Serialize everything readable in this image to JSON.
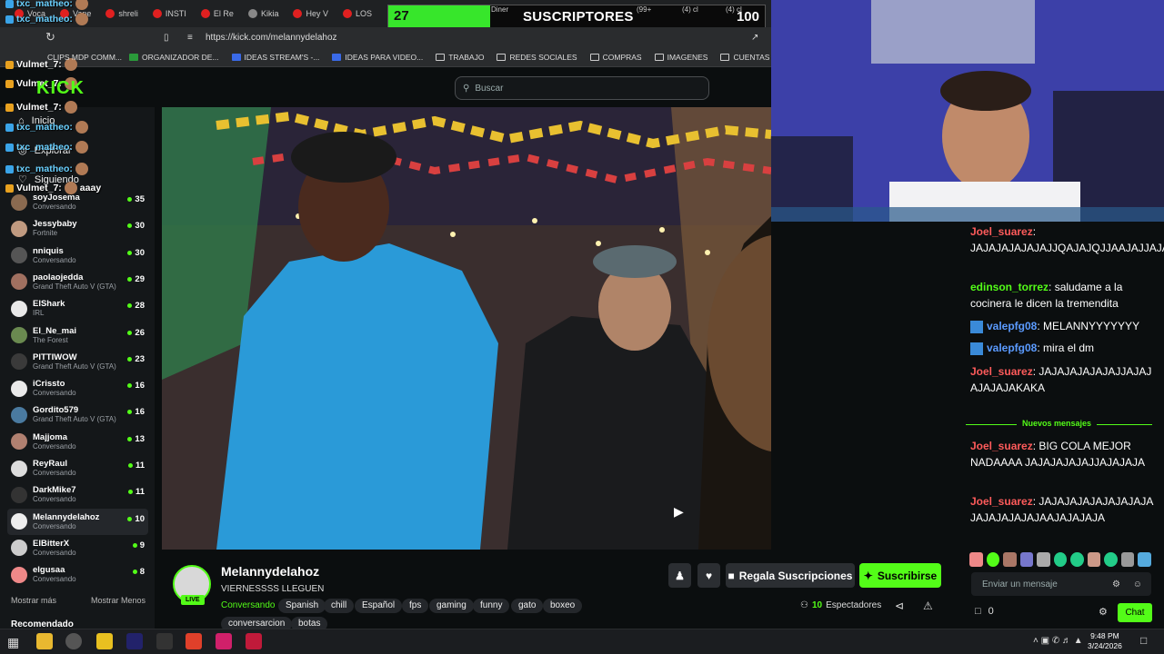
{
  "browser": {
    "tabs": [
      "Voca",
      "Vane",
      "shreli",
      "INSTI",
      "El Re",
      "Kikia",
      "Hey V",
      "LOS",
      "Diner",
      "(99+",
      "(4) cl",
      "(4) cl"
    ],
    "url": "https://kick.com/melannydelahoz",
    "bookmarks": [
      "CLIPS MDP COMM...",
      "ORGANIZADOR DE...",
      "IDEAS STREAM'S -...",
      "IDEAS PARA VIDEO...",
      "TRABAJO",
      "REDES SOCIALES",
      "COMPRAS",
      "IMAGENES",
      "CUENTAS",
      "IA"
    ]
  },
  "sub_goal": {
    "label": "SUSCRIPTORES",
    "start": "27",
    "goal": "100",
    "progress": 0.27
  },
  "search": {
    "placeholder": "Buscar"
  },
  "sidebar": {
    "nav": [
      "Inicio",
      "Explorar",
      "Siguiendo"
    ],
    "channels": [
      {
        "name": "soyJosema",
        "category": "Conversando",
        "viewers": "35"
      },
      {
        "name": "Jessybaby",
        "category": "Fortnite",
        "viewers": "30"
      },
      {
        "name": "nniquis",
        "category": "Conversando",
        "viewers": "30"
      },
      {
        "name": "paolaojedda",
        "category": "Grand Theft Auto V (GTA)",
        "viewers": "29"
      },
      {
        "name": "ElShark",
        "category": "IRL",
        "viewers": "28"
      },
      {
        "name": "El_Ne_mai",
        "category": "The Forest",
        "viewers": "26"
      },
      {
        "name": "PITTIWOW",
        "category": "Grand Theft Auto V (GTA)",
        "viewers": "23"
      },
      {
        "name": "iCrissto",
        "category": "Conversando",
        "viewers": "16"
      },
      {
        "name": "Gordito579",
        "category": "Grand Theft Auto V (GTA)",
        "viewers": "16"
      },
      {
        "name": "Majjoma",
        "category": "Conversando",
        "viewers": "13"
      },
      {
        "name": "ReyRaul",
        "category": "Conversando",
        "viewers": "11"
      },
      {
        "name": "DarkMike7",
        "category": "Conversando",
        "viewers": "11"
      },
      {
        "name": "Melannydelahoz",
        "category": "Conversando",
        "viewers": "10"
      },
      {
        "name": "ElBitterX",
        "category": "Conversando",
        "viewers": "9"
      },
      {
        "name": "elgusaa",
        "category": "Conversando",
        "viewers": "8"
      }
    ],
    "show_more": "Mostrar más",
    "show_less": "Mostrar Menos",
    "recommended": "Recomendado"
  },
  "overlay_chat": [
    {
      "user": "txc_matheo:",
      "text": ""
    },
    {
      "user": "txc_matheo:",
      "text": ""
    },
    {
      "user": "Vulmet_7:",
      "text": ""
    },
    {
      "user": "Vulmet_7:",
      "text": ""
    },
    {
      "user": "Vulmet_7:",
      "text": ""
    },
    {
      "user": "txc_matheo:",
      "text": ""
    },
    {
      "user": "txc_matheo:",
      "text": ""
    },
    {
      "user": "txc_matheo:",
      "text": ""
    },
    {
      "user": "Vulmet_7:",
      "text": "aaay"
    }
  ],
  "stream": {
    "channel_name": "Melannydelahoz",
    "title": "VIERNESSSS LLEGUEN",
    "category": "Conversando",
    "live_label": "LIVE",
    "tags": [
      "Spanish",
      "chill",
      "Español",
      "fps",
      "gaming",
      "funny",
      "gato",
      "boxeo",
      "conversarcion",
      "botas"
    ],
    "gift_button": "Regala Suscripciones",
    "subscribe_button": "Suscribirse",
    "viewers": "10",
    "viewers_label": "Espectadores"
  },
  "chat": {
    "messages": [
      {
        "user": "Joel_suarez",
        "text": "JAJAJAJAJAJAJJQAJAJQJJAAJAJJAJA",
        "color": "#ff5b5b"
      },
      {
        "user": "edinson_torrez",
        "text": "saludame a la cocinera le dicen la tremendita",
        "color": "#53fc18"
      },
      {
        "user": "valepfg08",
        "text": "MELANNYYYYYYY",
        "color": "#5b9bff"
      },
      {
        "user": "valepfg08",
        "text": "mira el dm",
        "color": "#5b9bff"
      },
      {
        "user": "Joel_suarez",
        "text": "JAJAJAJAJAJAJJAJAJAJAJAJAKAKA",
        "color": "#ff5b5b"
      },
      {
        "user": "Joel_suarez",
        "text": "BIG COLA MEJOR NADAAAA JAJAJAJAJAJJAJAJAJA",
        "color": "#ff5b5b"
      },
      {
        "user": "Joel_suarez",
        "text": "JAJAJAJAJAJAJAJAJAJAJAJAJAJAJAAJAJAJAJA",
        "color": "#ff5b5b"
      }
    ],
    "new_messages_divider": "Nuevos mensajes",
    "input_placeholder": "Enviar un mensaje",
    "points": "0",
    "send_button": "Chat"
  },
  "taskbar": {
    "time": "9:48 PM",
    "date": "3/24/2026"
  }
}
